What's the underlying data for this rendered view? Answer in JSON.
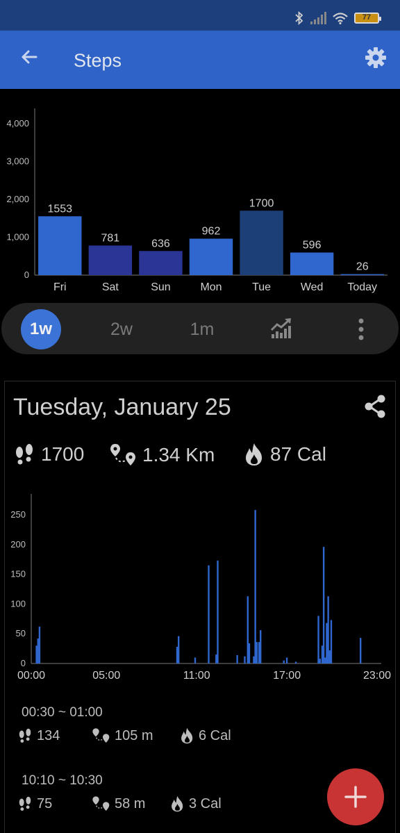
{
  "status_bar": {
    "battery": "77"
  },
  "app_bar": {
    "title": "Steps"
  },
  "week_chart": {
    "y_ticks": [
      "0",
      "1,000",
      "2,000",
      "3,000",
      "4,000"
    ]
  },
  "chart_data": [
    {
      "type": "bar",
      "categories": [
        "Fri",
        "Sat",
        "Sun",
        "Mon",
        "Tue",
        "Wed",
        "Today"
      ],
      "values": [
        1553,
        781,
        636,
        962,
        1700,
        596,
        26
      ],
      "ylim": [
        0,
        4400
      ],
      "colors": [
        "#2f67cf",
        "#2a3596",
        "#2a3596",
        "#2f67cf",
        "#1c3f78",
        "#2f67cf",
        "#2f67cf"
      ]
    },
    {
      "type": "bar",
      "x_ticks": [
        "00:00",
        "05:00",
        "11:00",
        "17:00",
        "23:00"
      ],
      "y_ticks": [
        "0",
        "50",
        "100",
        "150",
        "200",
        "250"
      ],
      "ylim": [
        0,
        285
      ],
      "x_range_hours": [
        0,
        23
      ],
      "bars": [
        {
          "t": 0.35,
          "v": 30
        },
        {
          "t": 0.45,
          "v": 42
        },
        {
          "t": 0.55,
          "v": 62
        },
        {
          "t": 9.7,
          "v": 28
        },
        {
          "t": 9.8,
          "v": 46
        },
        {
          "t": 10.9,
          "v": 10
        },
        {
          "t": 11.8,
          "v": 165
        },
        {
          "t": 12.3,
          "v": 15
        },
        {
          "t": 12.4,
          "v": 173
        },
        {
          "t": 13.7,
          "v": 14
        },
        {
          "t": 14.2,
          "v": 12
        },
        {
          "t": 14.4,
          "v": 113
        },
        {
          "t": 14.5,
          "v": 34
        },
        {
          "t": 14.8,
          "v": 12
        },
        {
          "t": 14.9,
          "v": 258
        },
        {
          "t": 15.0,
          "v": 36
        },
        {
          "t": 15.15,
          "v": 36
        },
        {
          "t": 15.25,
          "v": 56
        },
        {
          "t": 16.8,
          "v": 5
        },
        {
          "t": 17.0,
          "v": 10
        },
        {
          "t": 17.6,
          "v": 3
        },
        {
          "t": 19.1,
          "v": 80
        },
        {
          "t": 19.2,
          "v": 8
        },
        {
          "t": 19.35,
          "v": 30
        },
        {
          "t": 19.45,
          "v": 196
        },
        {
          "t": 19.55,
          "v": 10
        },
        {
          "t": 19.65,
          "v": 68
        },
        {
          "t": 19.75,
          "v": 113
        },
        {
          "t": 19.85,
          "v": 22
        },
        {
          "t": 19.95,
          "v": 73
        },
        {
          "t": 21.9,
          "v": 43
        }
      ]
    }
  ],
  "ranges": {
    "one_week": "1w",
    "two_weeks": "2w",
    "one_month": "1m"
  },
  "detail": {
    "date": "Tuesday, January 25",
    "steps": "1700",
    "distance": "1.34 Km",
    "calories": "87 Cal",
    "entries": [
      {
        "time": "00:30 ~ 01:00",
        "steps": "134",
        "distance": "105 m",
        "calories": "6 Cal"
      },
      {
        "time": "10:10 ~ 10:30",
        "steps": "75",
        "distance": "58 m",
        "calories": "3 Cal"
      }
    ]
  },
  "fab": {
    "label": "+"
  }
}
